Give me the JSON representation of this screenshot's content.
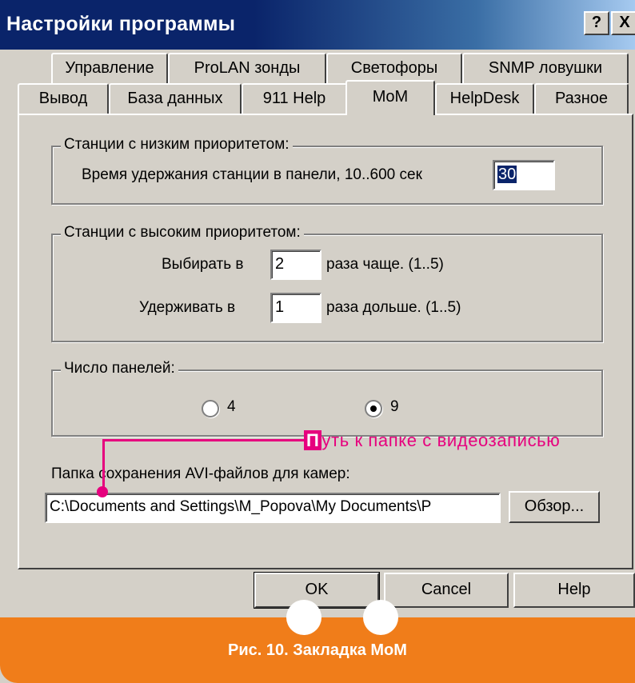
{
  "window": {
    "title": "Настройки программы",
    "help_btn": "?",
    "close_btn": "X"
  },
  "tabs_row1": [
    "Управление",
    "ProLAN зонды",
    "Светофоры",
    "SNMP ловушки"
  ],
  "tabs_row2": [
    "Вывод",
    "База данных",
    "911 Help",
    "MoM",
    "HelpDesk",
    "Разное"
  ],
  "active_tab": "MoM",
  "low_priority": {
    "title": "Станции с низким приоритетом:",
    "hold_label": "Время удержания станции в панели, 10..600 сек",
    "hold_value": "30"
  },
  "high_priority": {
    "title": "Станции с высоким приоритетом:",
    "choose_label": "Выбирать в",
    "choose_value": "2",
    "choose_suffix": "раза чаще. (1..5)",
    "keep_label": "Удерживать в",
    "keep_value": "1",
    "keep_suffix": "раза дольше. (1..5)"
  },
  "panels": {
    "title": "Число панелей:",
    "options": [
      "4",
      "9"
    ],
    "selected": "9"
  },
  "avi": {
    "label": "Папка сохранения AVI-файлов для камер:",
    "path": "C:\\Documents and Settings\\M_Popova\\My Documents\\P",
    "browse": "Обзор..."
  },
  "buttons": {
    "ok": "OK",
    "cancel": "Cancel",
    "help": "Help"
  },
  "annotation": {
    "first_letter": "П",
    "rest": "уть к папке с видеозаписью",
    "color": "#e6007e"
  },
  "caption": {
    "text": "Рис. 10. Закладка MoM",
    "color": "#f07d1a"
  }
}
